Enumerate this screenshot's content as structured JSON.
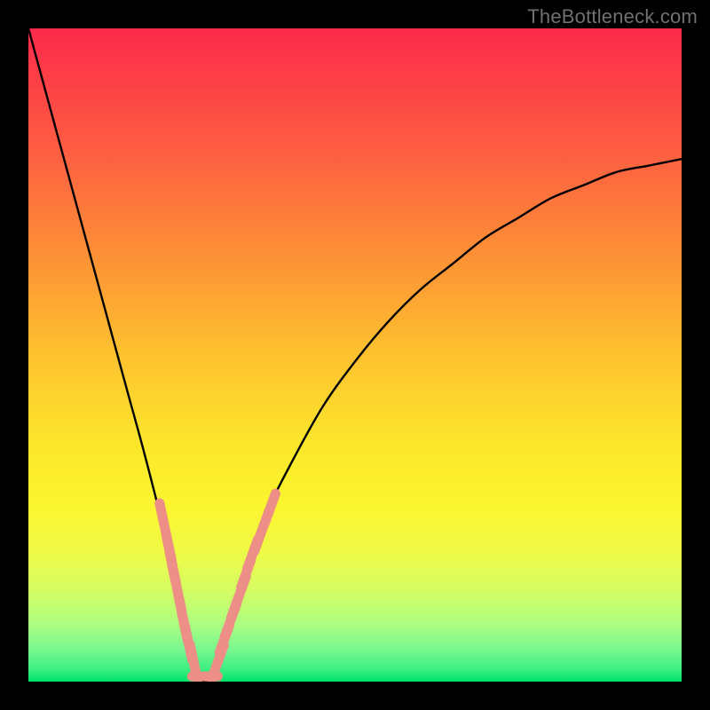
{
  "watermark": {
    "text": "TheBottleneck.com"
  },
  "chart_data": {
    "type": "line",
    "title": "",
    "xlabel": "",
    "ylabel": "",
    "xlim": [
      0,
      100
    ],
    "ylim": [
      0,
      100
    ],
    "grid": false,
    "legend": false,
    "background_gradient": {
      "top_color": "#fd2a4b",
      "mid_colors": [
        "#fd7c3a",
        "#fec52f",
        "#fbf22a",
        "#f0fa46",
        "#b7fe76"
      ],
      "bottom_color": "#00e36b"
    },
    "curve": {
      "description": "V-shaped bottleneck curve; minimum ~0 around x≈27; rises to 100 at x=0 and ~80 at x=100",
      "x": [
        0,
        3,
        6,
        9,
        12,
        15,
        18,
        21,
        23,
        25,
        27,
        29,
        31,
        33,
        36,
        40,
        45,
        50,
        55,
        60,
        65,
        70,
        75,
        80,
        85,
        90,
        95,
        100
      ],
      "y": [
        100,
        89,
        78,
        67,
        56,
        45,
        34,
        22,
        12,
        4,
        0,
        4,
        10,
        17,
        25,
        33,
        42,
        49,
        55,
        60,
        64,
        68,
        71,
        74,
        76,
        78,
        79,
        80
      ]
    },
    "marker_clusters": {
      "description": "Salmon rounded hash marks along the lower V region",
      "color": "#ed8e87",
      "left_branch": [
        {
          "x": 21.0,
          "y": 23.0,
          "len": 4.0
        },
        {
          "x": 21.6,
          "y": 20.0,
          "len": 2.0
        },
        {
          "x": 22.1,
          "y": 17.5,
          "len": 2.2
        },
        {
          "x": 22.7,
          "y": 14.5,
          "len": 3.2
        },
        {
          "x": 23.4,
          "y": 11.0,
          "len": 2.0
        },
        {
          "x": 23.9,
          "y": 8.5,
          "len": 2.0
        },
        {
          "x": 24.5,
          "y": 6.0,
          "len": 2.5
        },
        {
          "x": 25.3,
          "y": 3.0,
          "len": 2.5
        }
      ],
      "right_branch": [
        {
          "x": 29.0,
          "y": 3.0,
          "len": 2.5
        },
        {
          "x": 30.0,
          "y": 6.5,
          "len": 2.0
        },
        {
          "x": 31.0,
          "y": 9.5,
          "len": 2.5
        },
        {
          "x": 32.2,
          "y": 13.0,
          "len": 3.0
        },
        {
          "x": 33.3,
          "y": 16.5,
          "len": 2.0
        },
        {
          "x": 34.3,
          "y": 19.5,
          "len": 2.2
        },
        {
          "x": 35.7,
          "y": 23.0,
          "len": 3.0
        },
        {
          "x": 37.0,
          "y": 26.5,
          "len": 2.2
        }
      ],
      "flat_bottom": [
        {
          "x": 26.3,
          "y": 0.8,
          "w": 2.5
        },
        {
          "x": 28.0,
          "y": 0.8,
          "w": 2.0
        }
      ]
    }
  }
}
